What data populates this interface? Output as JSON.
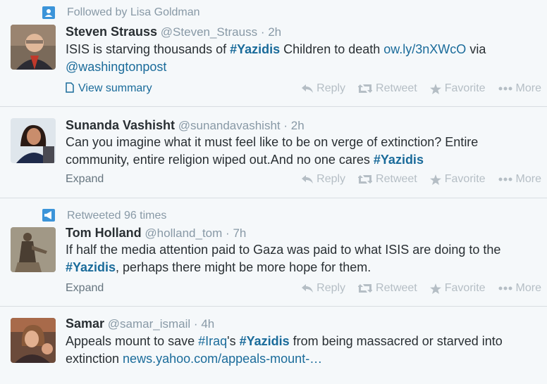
{
  "tweets": [
    {
      "context": "Followed by Lisa Goldman",
      "context_icon": "person-icon",
      "fullname": "Steven Strauss",
      "username": "@Steven_Strauss",
      "time": "2h",
      "text": {
        "p1": "ISIS is starving thousands of ",
        "h1": "#Yazidis",
        "p2": " Children to death ",
        "l1": "ow.ly/3nXWcO",
        "p3": " via ",
        "l2": "@washingtonpost"
      },
      "expand_label": "View summary"
    },
    {
      "fullname": "Sunanda Vashisht",
      "username": "@sunandavashisht",
      "time": "2h",
      "text": {
        "p1": "Can you imagine what it must feel like to be on verge of extinction? Entire community, entire religion wiped out.And no one cares ",
        "h1": "#Yazidis"
      },
      "expand_label": "Expand"
    },
    {
      "context": "Retweeted 96 times",
      "context_icon": "megaphone-icon",
      "fullname": "Tom Holland",
      "username": "@holland_tom",
      "time": "7h",
      "text": {
        "p1": "If half the media attention paid to Gaza was paid to what ISIS are doing to the ",
        "h1": "#Yazidis",
        "p2": ", perhaps there might be more hope for them."
      },
      "expand_label": "Expand"
    },
    {
      "fullname": "Samar",
      "username": "@samar_ismail",
      "time": "4h",
      "text": {
        "p1": "Appeals mount to save ",
        "h1": "#Iraq",
        "p2": "'s ",
        "h2": "#Yazidis",
        "p3": " from being massacred or starved into extinction ",
        "l1": "news.yahoo.com/appeals-mount-…"
      }
    }
  ],
  "actions": {
    "reply": "Reply",
    "retweet": "Retweet",
    "favorite": "Favorite",
    "more": "More"
  },
  "separator": "·",
  "colors": {
    "link": "#1a6b9a",
    "muted": "#8899a6",
    "action": "#b5bec5",
    "background": "#f5f8fa"
  }
}
